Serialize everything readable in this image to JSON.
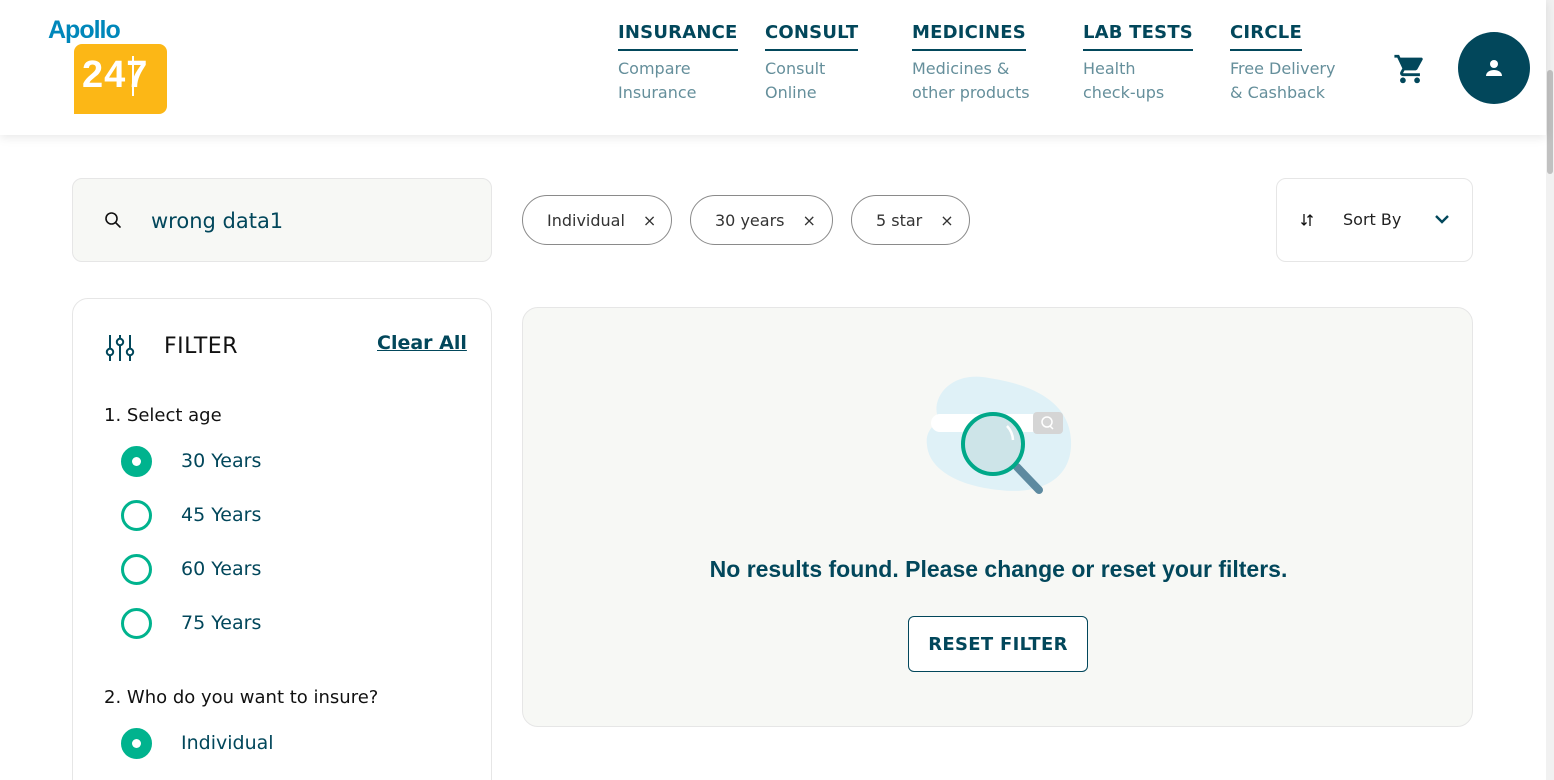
{
  "brand": {
    "name_text": "Apollo",
    "number_text": "247"
  },
  "nav": [
    {
      "title": "INSURANCE",
      "sub1": "Compare",
      "sub2": "Insurance"
    },
    {
      "title": "CONSULT",
      "sub1": "Consult",
      "sub2": "Online"
    },
    {
      "title": "MEDICINES",
      "sub1": "Medicines &",
      "sub2": "other products"
    },
    {
      "title": "LAB TESTS",
      "sub1": "Health",
      "sub2": "check-ups"
    },
    {
      "title": "CIRCLE",
      "sub1": "Free Delivery",
      "sub2": "& Cashback"
    }
  ],
  "icons": {
    "cart": "cart-icon",
    "profile": "user-icon",
    "search": "search-icon",
    "filter": "sliders-icon",
    "sort": "sort-arrows-icon",
    "chevron": "chevron-down-icon",
    "chip_close": "close-icon"
  },
  "search": {
    "value": "wrong data1"
  },
  "chips": [
    {
      "label": "Individual",
      "close": "×"
    },
    {
      "label": "30 years",
      "close": "×"
    },
    {
      "label": "5 star",
      "close": "×"
    }
  ],
  "sort": {
    "label": "Sort By"
  },
  "filter": {
    "title": "FILTER",
    "clear_all": "Clear All",
    "age_title": "1. Select age",
    "ages": [
      {
        "label": "30 Years",
        "selected": true
      },
      {
        "label": "45 Years",
        "selected": false
      },
      {
        "label": "60 Years",
        "selected": false
      },
      {
        "label": "75 Years",
        "selected": false
      }
    ],
    "insure_title": "2. Who do you want to insure?",
    "insure": [
      {
        "label": "Individual",
        "selected": true
      }
    ]
  },
  "results": {
    "message": "No results found. Please change or reset your filters.",
    "reset_label": "RESET FILTER"
  },
  "colors": {
    "primary": "#02475b",
    "accent": "#00b38e",
    "brand_yellow": "#fcb716",
    "brand_blue": "#0087ba"
  }
}
